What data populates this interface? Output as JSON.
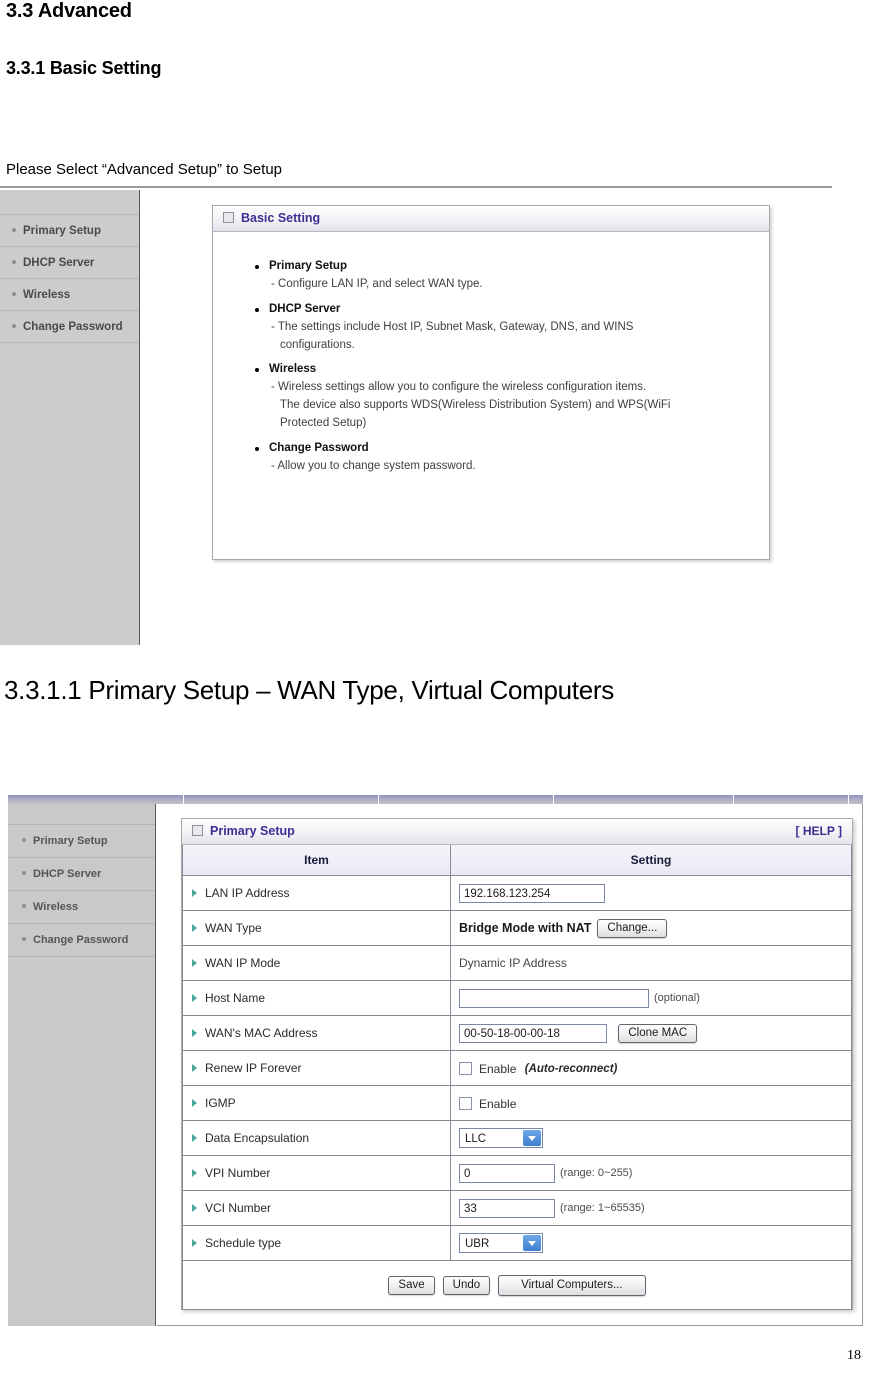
{
  "document": {
    "heading_section": "3.3 Advanced",
    "heading_subsection": "3.3.1 Basic Setting",
    "intro_paragraph": "Please Select “Advanced Setup” to Setup",
    "heading_subsubsection": "3.3.1.1 Primary Setup – WAN Type, Virtual Computers",
    "page_number": "18"
  },
  "screenshot1": {
    "sidebar": {
      "items": [
        {
          "label": "Primary Setup"
        },
        {
          "label": "DHCP Server"
        },
        {
          "label": "Wireless"
        },
        {
          "label": "Change Password"
        }
      ]
    },
    "panel": {
      "title": "Basic Setting",
      "items": [
        {
          "title": "Primary Setup",
          "desc": "- Configure LAN IP, and select WAN type.",
          "cont": ""
        },
        {
          "title": "DHCP Server",
          "desc": "- The settings include Host IP, Subnet Mask, Gateway, DNS, and WINS",
          "cont": "configurations."
        },
        {
          "title": "Wireless",
          "desc": "- Wireless settings allow you to configure the wireless configuration items.",
          "cont": "The device also supports WDS(Wireless Distribution System) and WPS(WiFi",
          "cont2": "Protected Setup)"
        },
        {
          "title": "Change Password",
          "desc": "- Allow you to change system password.",
          "cont": ""
        }
      ]
    }
  },
  "screenshot2": {
    "sidebar": {
      "items": [
        {
          "label": "Primary Setup"
        },
        {
          "label": "DHCP Server"
        },
        {
          "label": "Wireless"
        },
        {
          "label": "Change Password"
        }
      ]
    },
    "panel": {
      "title": "Primary Setup",
      "help_label": "[ HELP ]",
      "columns": {
        "item": "Item",
        "setting": "Setting"
      },
      "rows": {
        "lan_ip": {
          "label": "LAN IP Address",
          "value": "192.168.123.254"
        },
        "wan_type": {
          "label": "WAN Type",
          "value": "Bridge Mode with NAT",
          "button": "Change..."
        },
        "wan_ip_mode": {
          "label": "WAN IP Mode",
          "value": "Dynamic IP Address"
        },
        "host_name": {
          "label": "Host Name",
          "value": "",
          "placeholder": "",
          "hint": "(optional)"
        },
        "wan_mac": {
          "label": "WAN's MAC Address",
          "value": "00-50-18-00-00-18",
          "button": "Clone MAC"
        },
        "renew_ip": {
          "label": "Renew IP Forever",
          "checkbox_label": "Enable",
          "hint": "(Auto-reconnect)",
          "checked": false
        },
        "igmp": {
          "label": "IGMP",
          "checkbox_label": "Enable",
          "checked": false
        },
        "data_encap": {
          "label": "Data Encapsulation",
          "selected": "LLC"
        },
        "vpi": {
          "label": "VPI Number",
          "value": "0",
          "hint": "(range: 0~255)"
        },
        "vci": {
          "label": "VCI Number",
          "value": "33",
          "hint": "(range: 1~65535)"
        },
        "schedule_type": {
          "label": "Schedule type",
          "selected": "UBR"
        }
      },
      "actions": {
        "save": "Save",
        "undo": "Undo",
        "virtual_computers": "Virtual Computers..."
      }
    }
  }
}
